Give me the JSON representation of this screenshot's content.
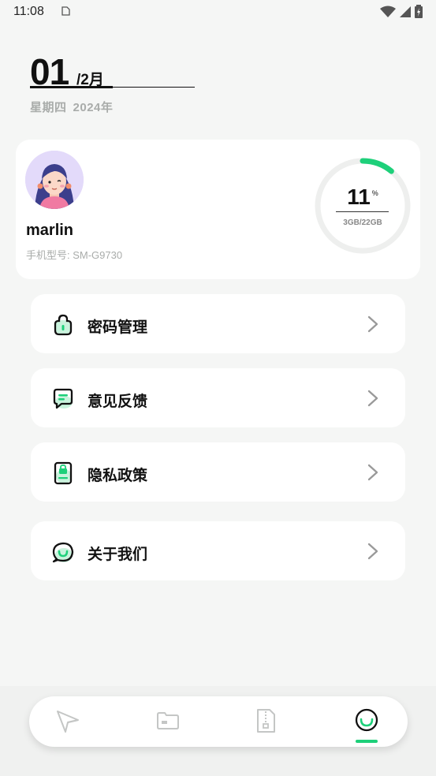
{
  "status_bar": {
    "time": "11:08"
  },
  "date": {
    "day": "01",
    "month": "/2月",
    "weekday": "星期四",
    "year": "2024年"
  },
  "profile": {
    "name": "marlin",
    "device_model": "手机型号: SM-G9730"
  },
  "storage": {
    "percent": "11",
    "percent_sign": "%",
    "usage": "3GB/22GB",
    "fraction_used": 0.11
  },
  "menu": [
    {
      "label": "密码管理",
      "icon": "lock-icon"
    },
    {
      "label": "意见反馈",
      "icon": "feedback-icon"
    },
    {
      "label": "隐私政策",
      "icon": "privacy-icon"
    },
    {
      "label": "关于我们",
      "icon": "about-icon"
    }
  ],
  "tabs": [
    {
      "icon": "send-icon",
      "active": false
    },
    {
      "icon": "folder-icon",
      "active": false
    },
    {
      "icon": "archive-icon",
      "active": false
    },
    {
      "icon": "profile-icon",
      "active": true
    }
  ],
  "colors": {
    "accent": "#1ed07a",
    "background": "#f5f6f5",
    "muted_text": "#a9acaa"
  }
}
